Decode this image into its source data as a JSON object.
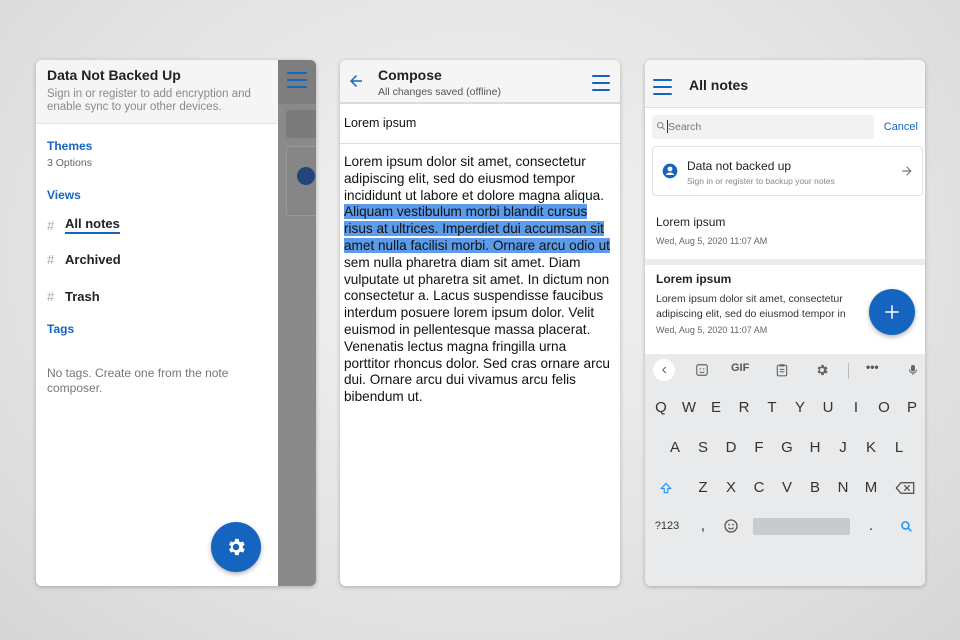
{
  "drawer": {
    "title": "Data Not Backed Up",
    "subtitle": "Sign in or register to add encryption and enable sync to your other devices.",
    "themes_label": "Themes",
    "themes_sub": "3 Options",
    "views_label": "Views",
    "items": [
      {
        "label": "All notes",
        "active": true
      },
      {
        "label": "Archived",
        "active": false
      },
      {
        "label": "Trash",
        "active": false
      }
    ],
    "hash": "#",
    "tags_label": "Tags",
    "tags_empty": "No tags. Create one from the note composer.",
    "fab_icon": "gear-icon"
  },
  "composer": {
    "title": "Compose",
    "status": "All changes saved (offline)",
    "note_title": "Lorem ipsum",
    "body_before": "Lorem ipsum dolor sit amet, consectetur adipiscing elit, sed do eiusmod tempor incididunt ut labore et dolore magna aliqua. ",
    "body_selected": "Aliquam vestibulum morbi blandit cursus risus at ultrices. Imperdiet dui accumsan sit amet nulla facilisi morbi. Ornare arcu odio ut",
    "body_after": " sem nulla pharetra diam sit amet. Diam vulputate ut pharetra sit amet. In dictum non consectetur a. Lacus suspendisse faucibus interdum posuere lorem ipsum dolor. Velit euismod in pellentesque massa placerat. Venenatis lectus magna fringilla urna porttitor rhoncus dolor. Sed cras ornare arcu dui. Ornare arcu dui vivamus arcu felis bibendum ut."
  },
  "notes": {
    "title": "All notes",
    "search_placeholder": "Search",
    "cancel_label": "Cancel",
    "backup_title": "Data not backed up",
    "backup_sub": "Sign in or register to backup your notes",
    "list": [
      {
        "title": "Lorem ipsum",
        "preview": "",
        "date": "Wed, Aug 5, 2020 11:07 AM",
        "bold": false
      },
      {
        "title": "Lorem ipsum",
        "preview": "Lorem ipsum dolor sit amet, consectetur adipiscing elit, sed do eiusmod tempor in",
        "date": "Wed, Aug 5, 2020 11:07 AM",
        "bold": true
      }
    ],
    "fab_icon": "plus-icon"
  },
  "keyboard": {
    "toolbar": [
      "<",
      "sticker",
      "GIF",
      "clipboard",
      "settings",
      "•••",
      "mic"
    ],
    "gif_label": "GIF",
    "more_label": "•••",
    "row1": [
      "Q",
      "W",
      "E",
      "R",
      "T",
      "Y",
      "U",
      "I",
      "O",
      "P"
    ],
    "row2": [
      "A",
      "S",
      "D",
      "F",
      "G",
      "H",
      "J",
      "K",
      "L"
    ],
    "row3": [
      "Z",
      "X",
      "C",
      "V",
      "B",
      "N",
      "M"
    ],
    "symbols_label": "?123",
    "comma": ",",
    "period": "."
  },
  "colors": {
    "accent": "#1565c0",
    "selection": "#5b9bea"
  }
}
